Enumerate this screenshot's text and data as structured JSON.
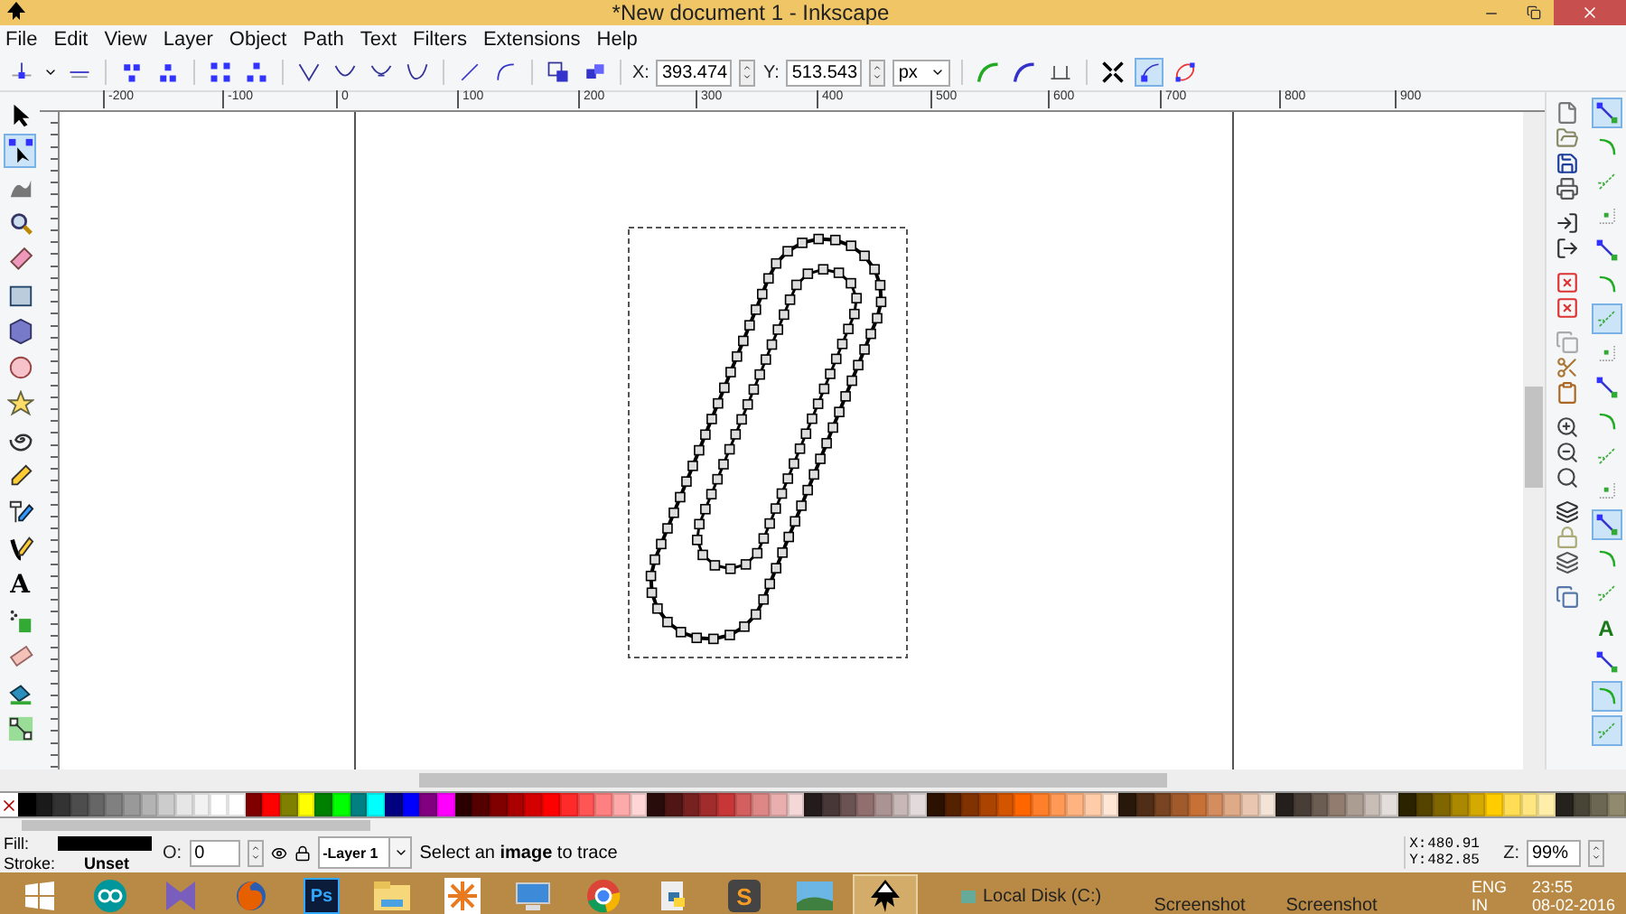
{
  "window": {
    "title": "*New document 1 - Inkscape"
  },
  "menu": [
    "File",
    "Edit",
    "View",
    "Layer",
    "Object",
    "Path",
    "Text",
    "Filters",
    "Extensions",
    "Help"
  ],
  "node_toolbar": {
    "buttons_left": [
      {
        "on": false
      },
      {
        "on": false
      },
      {
        "on": false
      },
      {
        "on": false
      },
      {
        "on": false
      },
      {
        "on": false
      },
      {
        "on": false
      },
      {
        "on": false
      },
      {
        "on": false
      },
      {
        "on": false
      },
      {
        "on": false
      },
      {
        "on": false
      },
      {
        "on": false
      },
      {
        "on": false
      }
    ],
    "x_label": "X:",
    "x_value": "393.474",
    "y_label": "Y:",
    "y_value": "513.543",
    "unit": "px",
    "buttons_right": [
      {
        "on": false
      },
      {
        "on": false
      },
      {
        "on": false
      },
      {
        "on": false
      },
      {
        "on": true
      },
      {
        "on": false
      }
    ]
  },
  "ruler_labels": [
    "-200",
    "-100",
    "0",
    "100",
    "200",
    "300",
    "400",
    "500",
    "600",
    "700",
    "800",
    "900"
  ],
  "tools": [
    {
      "selected": false
    },
    {
      "selected": true
    },
    {
      "selected": false
    },
    {
      "selected": false
    },
    {
      "selected": false
    },
    {
      "selected": false
    },
    {
      "selected": false
    },
    {
      "selected": false
    },
    {
      "selected": false
    },
    {
      "selected": false
    },
    {
      "selected": false
    },
    {
      "selected": false
    },
    {
      "selected": false
    },
    {
      "selected": false,
      "glyph": "A"
    },
    {
      "selected": false
    },
    {
      "selected": false
    },
    {
      "selected": false
    },
    {
      "selected": false
    }
  ],
  "snap_bar": [
    {
      "on": true
    },
    {
      "on": false
    },
    {
      "on": false
    },
    {
      "on": false
    },
    {
      "on": false
    },
    {
      "on": false
    },
    {
      "on": true
    },
    {
      "on": false
    },
    {
      "on": false
    },
    {
      "on": false
    },
    {
      "on": false
    },
    {
      "on": false
    },
    {
      "on": true
    },
    {
      "on": false
    },
    {
      "on": false
    },
    {
      "on": false,
      "glyph": "A"
    },
    {
      "on": false
    },
    {
      "on": true
    },
    {
      "on": true
    }
  ],
  "palette": [
    {
      "color": "#000000"
    },
    {
      "color": "#1a1a1a"
    },
    {
      "color": "#333333"
    },
    {
      "color": "#4d4d4d"
    },
    {
      "color": "#666666"
    },
    {
      "color": "#808080"
    },
    {
      "color": "#999999"
    },
    {
      "color": "#b3b3b3"
    },
    {
      "color": "#cccccc"
    },
    {
      "color": "#e6e6e6"
    },
    {
      "color": "#f2f2f2"
    },
    {
      "color": "#ffffff"
    },
    {
      "color": "#ffffff"
    },
    {
      "color": "#800000"
    },
    {
      "color": "#ff0000"
    },
    {
      "color": "#808000"
    },
    {
      "color": "#ffff00"
    },
    {
      "color": "#008000"
    },
    {
      "color": "#00ff00"
    },
    {
      "color": "#008080"
    },
    {
      "color": "#00ffff"
    },
    {
      "color": "#000080"
    },
    {
      "color": "#0000ff"
    },
    {
      "color": "#800080"
    },
    {
      "color": "#ff00ff"
    },
    {
      "color": "#2b0000"
    },
    {
      "color": "#550000"
    },
    {
      "color": "#800000"
    },
    {
      "color": "#aa0000"
    },
    {
      "color": "#d40000"
    },
    {
      "color": "#ff0000"
    },
    {
      "color": "#ff2a2a"
    },
    {
      "color": "#ff5555"
    },
    {
      "color": "#ff8080"
    },
    {
      "color": "#ffaaaa"
    },
    {
      "color": "#ffd5d5"
    },
    {
      "color": "#280b0b"
    },
    {
      "color": "#501616"
    },
    {
      "color": "#782121"
    },
    {
      "color": "#a02c2c"
    },
    {
      "color": "#c83737"
    },
    {
      "color": "#d35f5f"
    },
    {
      "color": "#de8787"
    },
    {
      "color": "#e9afaf"
    },
    {
      "color": "#f4d7d7"
    },
    {
      "color": "#241c1c"
    },
    {
      "color": "#483737"
    },
    {
      "color": "#6c5353"
    },
    {
      "color": "#916f6f"
    },
    {
      "color": "#ac9393"
    },
    {
      "color": "#c8b7b7"
    },
    {
      "color": "#e3dbdb"
    },
    {
      "color": "#2b1100"
    },
    {
      "color": "#552200"
    },
    {
      "color": "#803300"
    },
    {
      "color": "#aa4400"
    },
    {
      "color": "#d45500"
    },
    {
      "color": "#ff6600"
    },
    {
      "color": "#ff7f2a"
    },
    {
      "color": "#ff9955"
    },
    {
      "color": "#ffb380"
    },
    {
      "color": "#ffccaa"
    },
    {
      "color": "#ffe6d5"
    },
    {
      "color": "#28170b"
    },
    {
      "color": "#502d16"
    },
    {
      "color": "#784421"
    },
    {
      "color": "#a05a2c"
    },
    {
      "color": "#c87137"
    },
    {
      "color": "#d38d5f"
    },
    {
      "color": "#deaa87"
    },
    {
      "color": "#e9c6af"
    },
    {
      "color": "#f4e3d7"
    },
    {
      "color": "#241f1c"
    },
    {
      "color": "#483e37"
    },
    {
      "color": "#6c5d53"
    },
    {
      "color": "#917c6f"
    },
    {
      "color": "#ac9d93"
    },
    {
      "color": "#c8beb7"
    },
    {
      "color": "#e3dedb"
    },
    {
      "color": "#2b2200"
    },
    {
      "color": "#554400"
    },
    {
      "color": "#806600"
    },
    {
      "color": "#aa8800"
    },
    {
      "color": "#d4aa00"
    },
    {
      "color": "#ffcc00"
    },
    {
      "color": "#ffdd55"
    },
    {
      "color": "#ffe680"
    },
    {
      "color": "#ffeeaa"
    },
    {
      "color": "#24221c"
    },
    {
      "color": "#484537"
    },
    {
      "color": "#6c6753"
    },
    {
      "color": "#918a6f"
    }
  ],
  "status": {
    "fill_label": "Fill:",
    "stroke_label": "Stroke:",
    "stroke_value": "Unset",
    "opacity_label": "O:",
    "opacity_value": "0",
    "layer": "-Layer 1",
    "message": "Select an **image** to trace",
    "x_label": "X:",
    "x_value": "480.91",
    "y_label": "Y:",
    "y_value": "482.85",
    "zoom_label": "Z:",
    "zoom_value": "99%"
  },
  "taskbar": {
    "apps": [
      {
        "selected": false
      },
      {
        "selected": false
      },
      {
        "selected": false
      },
      {
        "selected": false
      },
      {
        "selected": false,
        "glyph": "Ps"
      },
      {
        "selected": false
      },
      {
        "selected": false
      },
      {
        "selected": false
      },
      {
        "selected": false
      },
      {
        "selected": false
      },
      {
        "selected": false,
        "glyph": "S"
      },
      {
        "selected": false
      },
      {
        "selected": true
      }
    ],
    "drive": "Local Disk (C:)",
    "thumbnails": [
      "Screenshot",
      "Screenshot"
    ],
    "language": "ENG",
    "region": "IN",
    "time": "23:55",
    "date": "08-02-2016"
  }
}
